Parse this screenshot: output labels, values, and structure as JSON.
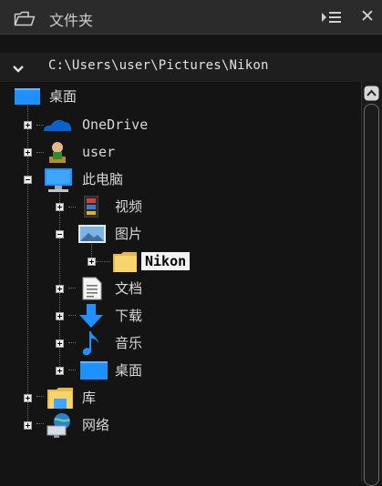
{
  "panel": {
    "title": "文件夹"
  },
  "path": {
    "value": "C:\\Users\\user\\Pictures\\Nikon"
  },
  "tree": {
    "desktop_root": "桌面",
    "onedrive": "OneDrive",
    "user": "user",
    "this_pc": "此电脑",
    "videos": "视频",
    "pictures": "图片",
    "nikon": "Nikon",
    "documents": "文档",
    "downloads": "下载",
    "music": "音乐",
    "desktop": "桌面",
    "libraries": "库",
    "network": "网络"
  },
  "colors": {
    "background": "#141414",
    "titlebar": "#2b2b2b",
    "selection": "#f2f2f2",
    "accent_blue": "#1e90ff"
  }
}
